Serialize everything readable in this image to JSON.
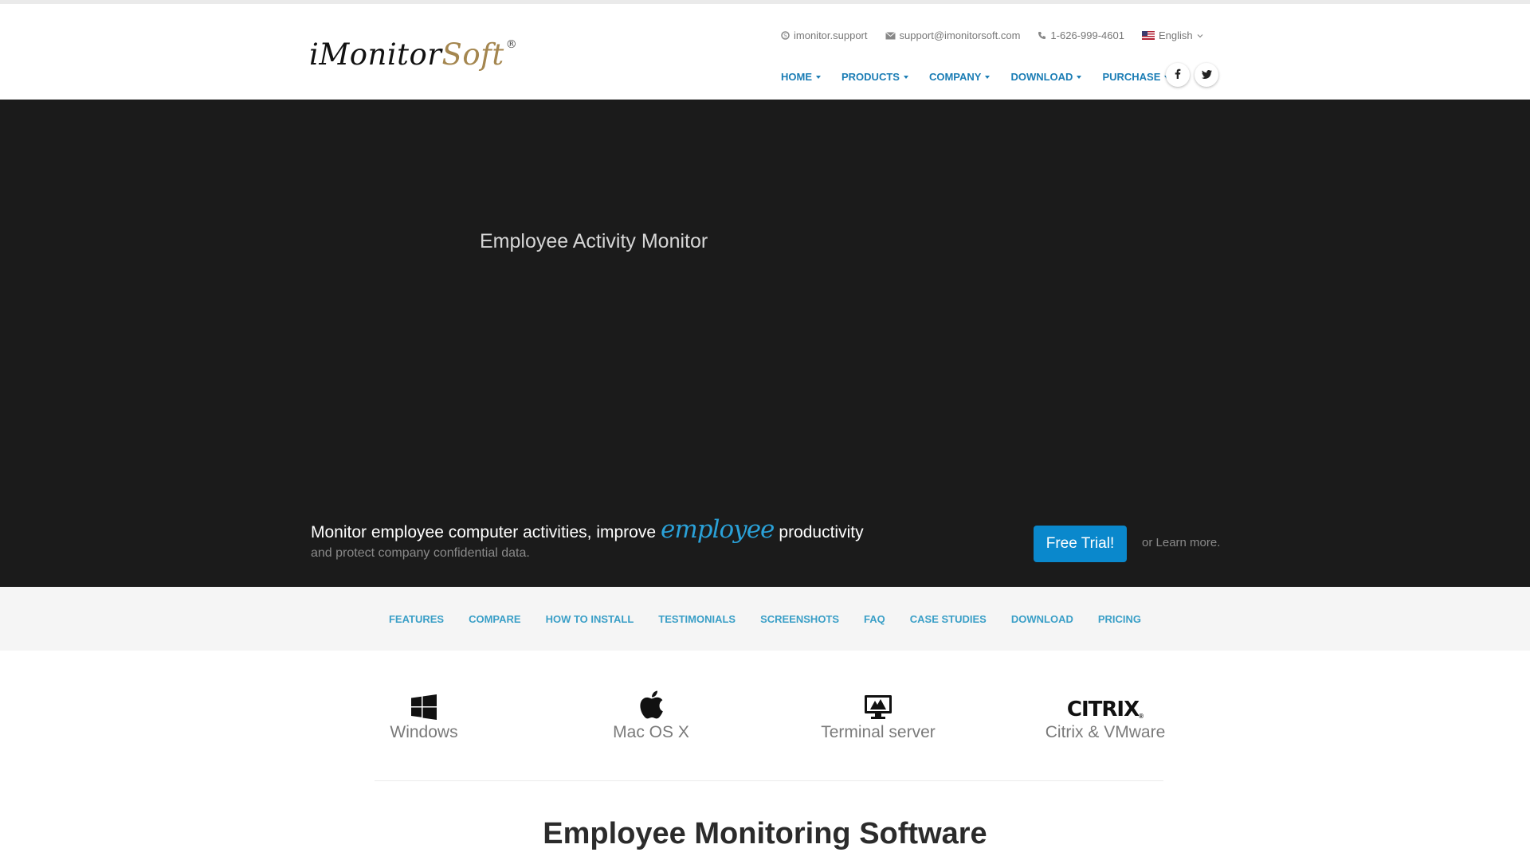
{
  "header": {
    "logo_main": "iMonitor",
    "logo_accent": "Soft",
    "logo_reg": "®",
    "contact": {
      "skype": "imonitor.support",
      "email": "support@imonitorsoft.com",
      "phone": "1-626-999-4601",
      "language": "English"
    },
    "nav": [
      "HOME",
      "PRODUCTS",
      "COMPANY",
      "DOWNLOAD",
      "PURCHASE"
    ],
    "social": [
      {
        "name": "facebook-icon",
        "glyph": "f"
      },
      {
        "name": "twitter-icon",
        "glyph": "t"
      }
    ]
  },
  "hero": {
    "video_title": "Employee Activity Monitor",
    "line1_before": "Monitor employee computer activities, improve",
    "line1_script": "employee",
    "line1_after": "productivity",
    "line2": "and protect company confidential data.",
    "cta_label": "Free Trial!",
    "learn_more": "or Learn more."
  },
  "subnav": [
    "FEATURES",
    "COMPARE",
    "HOW TO INSTALL",
    "TESTIMONIALS",
    "SCREENSHOTS",
    "FAQ",
    "CASE STUDIES",
    "DOWNLOAD",
    "PRICING"
  ],
  "platforms": [
    {
      "label": "Windows",
      "icon": "windows-icon"
    },
    {
      "label": "Mac OS X",
      "icon": "apple-icon"
    },
    {
      "label": "Terminal server",
      "icon": "monitor-icon"
    },
    {
      "label": "Citrix & VMware",
      "icon": "citrix-logo",
      "logo_text": "CITRIX"
    }
  ],
  "section": {
    "title": "Employee Monitoring Software"
  },
  "colors": {
    "brand_blue": "#1b7db5",
    "cta_blue": "#0a88cc",
    "script_blue": "#2aa1d8",
    "logo_gold": "#a4864f",
    "hero_bg": "#1b1b1b"
  }
}
